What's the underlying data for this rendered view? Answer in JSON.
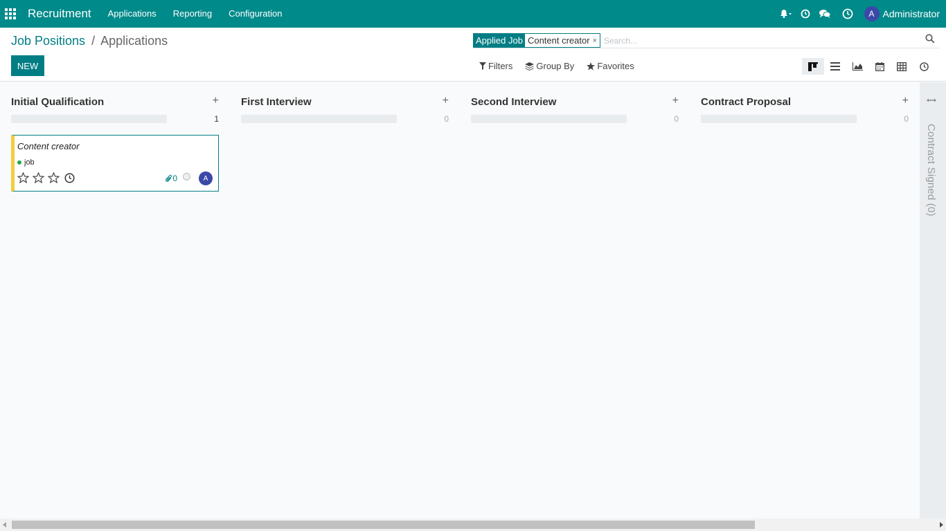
{
  "navbar": {
    "app_name": "Recruitment",
    "menu": [
      "Applications",
      "Reporting",
      "Configuration"
    ],
    "user": {
      "initial": "A",
      "name": "Administrator"
    },
    "icons": [
      "bell-icon",
      "clock-icon",
      "chat-icon",
      "activity-clock-icon"
    ]
  },
  "breadcrumb": {
    "parent": "Job Positions",
    "separator": "/",
    "current": "Applications"
  },
  "toolbar": {
    "new_label": "NEW"
  },
  "search": {
    "facet_label": "Applied Job",
    "facet_value": "Content creator",
    "facet_remove": "×",
    "placeholder": "Search..."
  },
  "filters": {
    "filters_label": "Filters",
    "groupby_label": "Group By",
    "favorites_label": "Favorites"
  },
  "views": [
    "kanban",
    "list",
    "graph",
    "calendar",
    "pivot",
    "activity"
  ],
  "kanban": {
    "columns": [
      {
        "title": "Initial Qualification",
        "count": "1"
      },
      {
        "title": "First Interview",
        "count": "0"
      },
      {
        "title": "Second Interview",
        "count": "0"
      },
      {
        "title": "Contract Proposal",
        "count": "0"
      }
    ],
    "add_symbol": "+",
    "folded_column": {
      "title": "Contract Signed (0)"
    },
    "card": {
      "title": "Content creator",
      "tag": "job",
      "stars": 0,
      "attachments": "0",
      "assignee_initial": "A"
    }
  },
  "colors": {
    "brand": "#018a8a",
    "primary": "#017e84",
    "avatar": "#3b48a8",
    "card_border_left": "#f0ce3f",
    "tag_dot": "#28a745"
  }
}
